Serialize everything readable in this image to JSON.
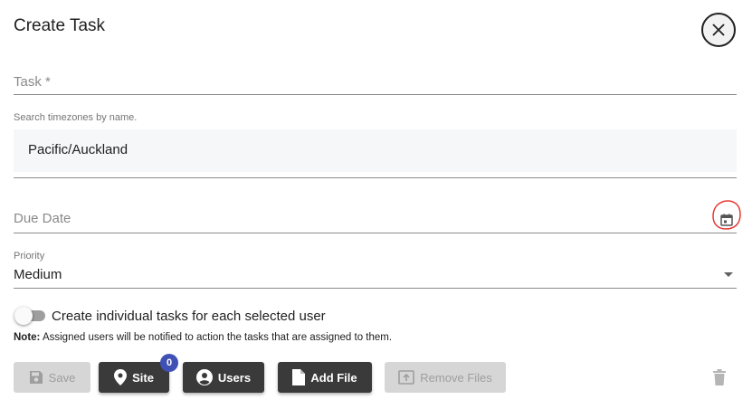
{
  "dialog": {
    "title": "Create Task",
    "close_icon": "close-icon"
  },
  "fields": {
    "task_label": "Task *",
    "timezone_helper": "Search timezones by name.",
    "timezone_value": "Pacific/Auckland",
    "due_date_label": "Due Date",
    "priority_label": "Priority",
    "priority_value": "Medium"
  },
  "toggle": {
    "label": "Create individual tasks for each selected user",
    "checked": false
  },
  "note": {
    "prefix": "Note:",
    "text": " Assigned users will be notified to action the tasks that are assigned to them."
  },
  "buttons": {
    "save": "Save",
    "site": "Site",
    "site_badge": "0",
    "users": "Users",
    "add_file": "Add File",
    "remove_files": "Remove Files"
  },
  "colors": {
    "dark_button": "#3a3a3a",
    "disabled_button": "#d6d6d6",
    "badge": "#3f51b5",
    "annotation_circle": "#e53935"
  }
}
